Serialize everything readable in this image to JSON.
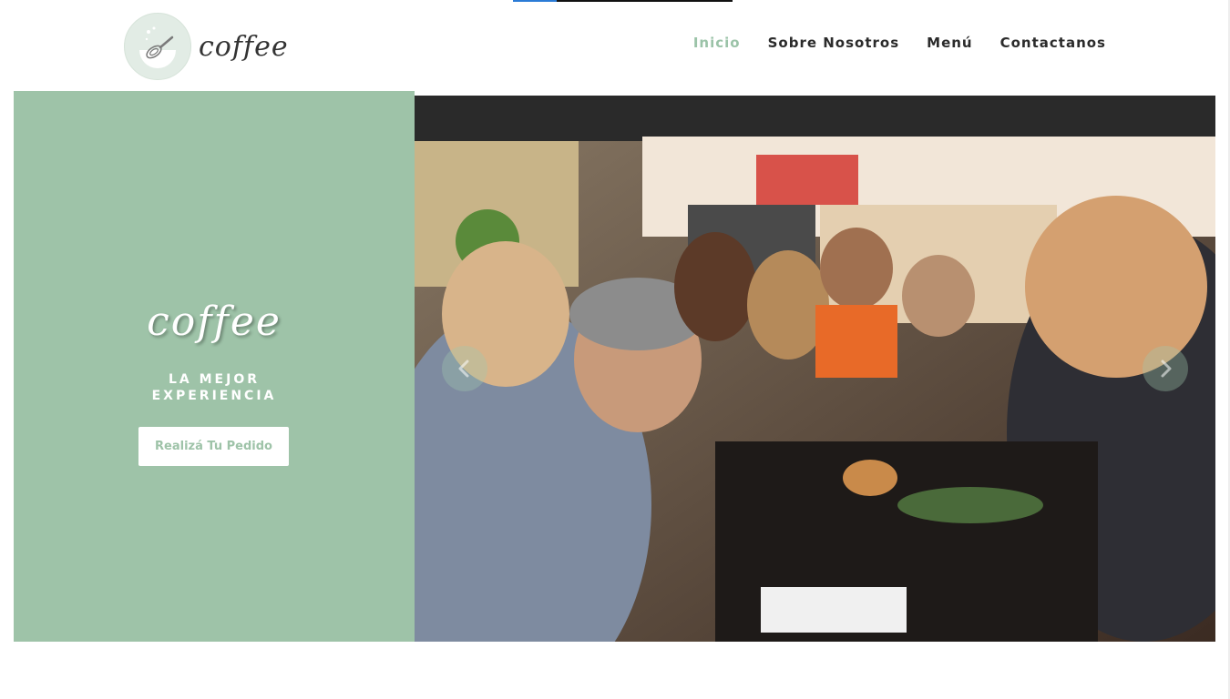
{
  "page": {
    "progress_fraction": 0.2
  },
  "header": {
    "logo_text": "coffee",
    "nav": [
      {
        "label": "Inicio",
        "active": true
      },
      {
        "label": "Sobre Nosotros",
        "active": false
      },
      {
        "label": "Menú",
        "active": false
      },
      {
        "label": "Contactanos",
        "active": false
      }
    ]
  },
  "hero": {
    "brand": "coffee",
    "tagline_line1": "LA MEJOR",
    "tagline_line2": "EXPERIENCIA",
    "cta_label": "Realizá Tu Pedido"
  },
  "carousel": {
    "prev_icon": "chevron-left-icon",
    "next_icon": "chevron-right-icon"
  },
  "colors": {
    "accent": "#9ec3a8",
    "nav_active": "#9bc3a8",
    "nav_text": "#2b2b2b",
    "progress_fill": "#2b7bd6"
  }
}
